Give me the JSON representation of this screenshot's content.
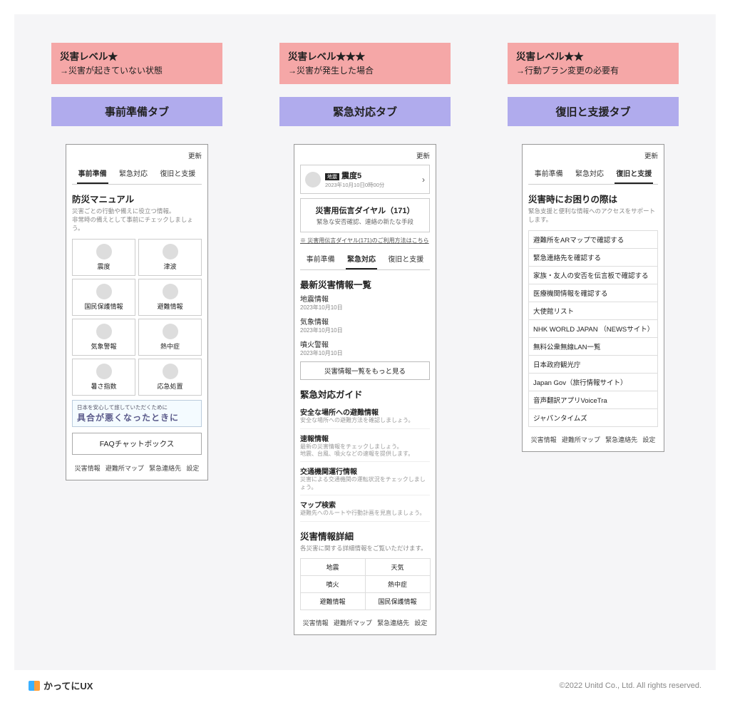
{
  "columns": [
    {
      "level_title": "災害レベル★",
      "level_sub": "→災害が起きていない状態",
      "tab_banner": "事前準備タブ"
    },
    {
      "level_title": "災害レベル★★★",
      "level_sub": "→災害が発生した場合",
      "tab_banner": "緊急対応タブ"
    },
    {
      "level_title": "災害レベル★★",
      "level_sub": "→行動プラン変更の必要有",
      "tab_banner": "復旧と支援タブ"
    }
  ],
  "update_label": "更新",
  "tabs": {
    "prep": "事前準備",
    "emerg": "緊急対応",
    "recov": "復旧と支援"
  },
  "bottom": {
    "a": "災害情報",
    "b": "避難所マップ",
    "c": "緊急連絡先",
    "d": "設定"
  },
  "prep": {
    "title": "防災マニュアル",
    "desc1": "災害ごとの行動や備えに役立つ情報。",
    "desc2": "非常時の備えとして事前にチェックしましょう。",
    "tiles": [
      "震度",
      "津波",
      "国民保護情報",
      "避難情報",
      "気象警報",
      "熱中症",
      "暑さ指数",
      "応急処置"
    ],
    "ad_line1": "日本を安心して旅していただくために",
    "ad_line2": "具合が悪くなったときに",
    "faq": "FAQチャットボックス"
  },
  "emerg": {
    "alert_tag": "地震",
    "alert_title": "震度5",
    "alert_time": "2023年10月10日0時00分",
    "promo_title": "災害用伝言ダイヤル（171）",
    "promo_desc": "緊急な安否確認、連絡の新たな手段",
    "promo_link": "※ 災害用伝言ダイヤル(171)のご利用方法はこちら",
    "news_title": "最新災害情報一覧",
    "news": [
      {
        "t": "地震情報",
        "d": "2023年10月10日"
      },
      {
        "t": "気象情報",
        "d": "2023年10月10日"
      },
      {
        "t": "噴火警報",
        "d": "2023年10月10日"
      }
    ],
    "more": "災害情報一覧をもっと見る",
    "guide_title": "緊急対応ガイド",
    "guides": [
      {
        "t": "安全な場所への避難情報",
        "d": "安全な場所への避難方法を確認しましょう。"
      },
      {
        "t": "速報情報",
        "d": "最新の災害情報をチェックしましょう。\n地震、台風、噴火などの速報を提供します。"
      },
      {
        "t": "交通機関運行情報",
        "d": "災害による交通機関の運転状況をチェックしましょう。"
      },
      {
        "t": "マップ検索",
        "d": "避難先へのルートや行動計画を見直しましょう。"
      }
    ],
    "detail_title": "災害情報詳細",
    "detail_desc": "各災害に関する詳細情報をご覧いただけます。",
    "details": [
      "地震",
      "天気",
      "噴火",
      "熱中症",
      "避難情報",
      "国民保護情報"
    ]
  },
  "recov": {
    "title": "災害時にお困りの際は",
    "desc": "緊急支援と便利な情報へのアクセスをサポートします。",
    "links": [
      "避難所をARマップで確認する",
      "緊急連絡先を確認する",
      "家族・友人の安否を伝言板で確認する",
      "医療機関情報を確認する",
      "大使館リスト",
      "NHK WORLD JAPAN （NEWSサイト）",
      "無料公衆無線LAN一覧",
      "日本政府観光庁",
      "Japan Gov（旅行情報サイト）",
      "音声翻訳アプリVoiceTra",
      "ジャパンタイムズ"
    ]
  },
  "footer": {
    "brand": "かってにUX",
    "copy": "©2022 Unitd Co., Ltd. All rights reserved."
  }
}
